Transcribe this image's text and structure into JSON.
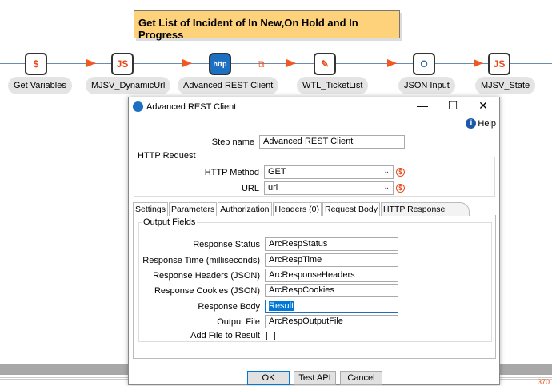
{
  "canvas": {
    "note": "Get List of Incident of In New,On Hold and In Progress",
    "steps": [
      {
        "label": "Get Variables",
        "icon": "hand-coin-icon"
      },
      {
        "label": "MJSV_DynamicUrl",
        "icon": "javascript-file-icon"
      },
      {
        "label": "Advanced REST Client",
        "icon": "http-globe-icon"
      },
      {
        "label": "WTL_TicketList",
        "icon": "write-file-icon"
      },
      {
        "label": "JSON Input",
        "icon": "json-input-icon"
      },
      {
        "label": "MJSV_State",
        "icon": "javascript-file-icon"
      }
    ],
    "status_number": "370"
  },
  "dialog": {
    "title": "Advanced REST Client",
    "help": "Help",
    "step_name_label": "Step name",
    "step_name": "Advanced REST Client",
    "http_request_label": "HTTP Request",
    "http_method_label": "HTTP Method",
    "http_method": "GET",
    "url_label": "URL",
    "url": "url",
    "tabs": [
      "Settings",
      "Parameters",
      "Authorization",
      "Headers (0)",
      "Request Body",
      "HTTP Response"
    ],
    "output_fields_label": "Output Fields",
    "fields": [
      {
        "label": "Response Status",
        "value": "ArcRespStatus"
      },
      {
        "label": "Response Time (milliseconds)",
        "value": "ArcRespTime"
      },
      {
        "label": "Response Headers (JSON)",
        "value": "ArcResponseHeaders"
      },
      {
        "label": "Response Cookies (JSON)",
        "value": "ArcRespCookies"
      },
      {
        "label": "Response Body",
        "value": "Result"
      },
      {
        "label": "Output File",
        "value": "ArcRespOutputFile"
      }
    ],
    "add_file_label": "Add File to Result",
    "ok": "OK",
    "test": "Test API",
    "cancel": "Cancel"
  }
}
